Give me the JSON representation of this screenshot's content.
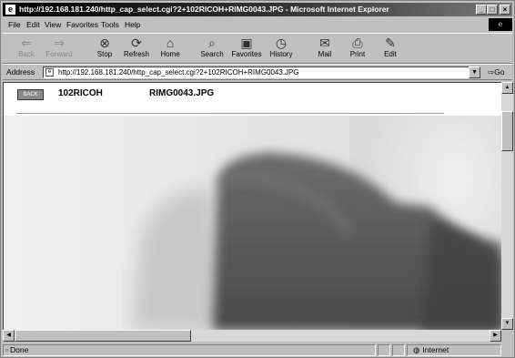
{
  "window": {
    "title": "http://192.168.181.240/http_cap_select.cgi?2+102RICOH+RIMG0043.JPG - Microsoft Internet Explorer",
    "minimize": "_",
    "maximize": "□",
    "close": "×",
    "throbber": "e"
  },
  "menu": [
    {
      "label": "File"
    },
    {
      "label": "Edit"
    },
    {
      "label": "View"
    },
    {
      "label": "Favorites"
    },
    {
      "label": "Tools"
    },
    {
      "label": "Help"
    }
  ],
  "toolbar": [
    {
      "label": "Back",
      "icon": "⇐",
      "icon_name": "back-arrow-icon",
      "enabled": false
    },
    {
      "label": "Forward",
      "icon": "⇒",
      "icon_name": "forward-arrow-icon",
      "enabled": false
    },
    {
      "label": "Stop",
      "icon": "⊗",
      "icon_name": "stop-icon",
      "enabled": true
    },
    {
      "label": "Refresh",
      "icon": "⟳",
      "icon_name": "refresh-icon",
      "enabled": true
    },
    {
      "label": "Home",
      "icon": "⌂",
      "icon_name": "home-icon",
      "enabled": true
    },
    {
      "label": "Search",
      "icon": "⌕",
      "icon_name": "search-icon",
      "enabled": true
    },
    {
      "label": "Favorites",
      "icon": "▣",
      "icon_name": "favorites-icon",
      "enabled": true
    },
    {
      "label": "History",
      "icon": "◷",
      "icon_name": "history-icon",
      "enabled": true
    },
    {
      "label": "Mail",
      "icon": "✉",
      "icon_name": "mail-icon",
      "enabled": true
    },
    {
      "label": "Print",
      "icon": "⎙",
      "icon_name": "print-icon",
      "enabled": true
    },
    {
      "label": "Edit",
      "icon": "✎",
      "icon_name": "edit-icon",
      "enabled": true
    }
  ],
  "address": {
    "label": "Address",
    "url": "http://192.168.181.240/http_cap_select.cgi?2+102RICOH+RIMG0043.JPG",
    "go_label": "Go"
  },
  "page": {
    "back_thumb_label": "BACK",
    "folder": "102RICOH",
    "filename": "RIMG0043.JPG"
  },
  "status": {
    "text": "Done",
    "zone": "Internet"
  },
  "colors": {
    "titlebar_start": "#000000",
    "titlebar_end": "#7a7a7a",
    "chrome": "#c0c0c0",
    "content_bg": "#ffffff"
  }
}
